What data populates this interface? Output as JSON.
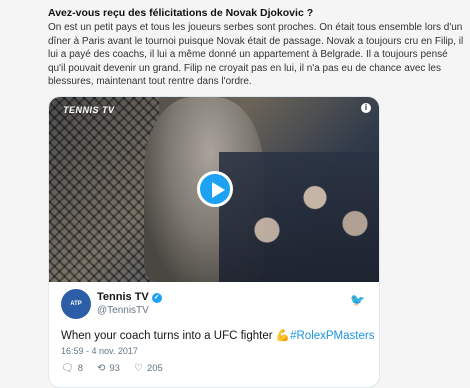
{
  "article": {
    "question": "Avez-vous reçu des félicitations de Novak Djokovic ?",
    "answer": "On est un petit pays et tous les joueurs serbes sont proches. On était tous ensemble lors d'un dîner à Paris avant le tournoi puisque Novak était de passage. Novak a toujours cru en Filip, il lui a payé des coachs, il lui a même donné un appartement à Belgrade. Il a toujours pensé qu'il pouvait devenir un grand. Filip ne croyait pas en lui, il n'a pas eu de chance avec les blessures, maintenant tout rentre dans l'ordre."
  },
  "tweet": {
    "video_logo": "TENNIS TV",
    "author_name": "Tennis TV",
    "author_handle": "@TennisTV",
    "avatar_text": "ATP",
    "text_main": "When your coach turns into a UFC fighter ",
    "emoji": "💪",
    "hashtag": "#RolexPMasters",
    "timestamp": "16:59 - 4 nov. 2017",
    "replies": "8",
    "retweets": "93",
    "likes": "205",
    "icons": {
      "reply": "reply-icon",
      "retweet": "retweet-icon",
      "like": "heart-icon",
      "bird": "twitter-bird-icon",
      "play": "play-icon",
      "info": "info-icon",
      "verified": "verified-badge-icon"
    },
    "colors": {
      "accent": "#1da1f2",
      "hashtag": "#1b95e0"
    }
  }
}
